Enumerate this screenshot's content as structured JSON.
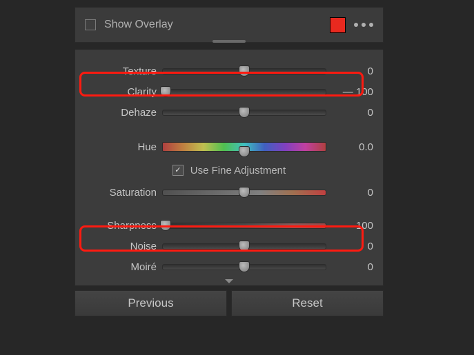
{
  "header": {
    "show_overlay_label": "Show Overlay",
    "swatch_color": "#e8291f"
  },
  "sliders": {
    "texture": {
      "label": "Texture",
      "value": "0",
      "pos": 50
    },
    "clarity": {
      "label": "Clarity",
      "value": "— 100",
      "pos": 0
    },
    "dehaze": {
      "label": "Dehaze",
      "value": "0",
      "pos": 50
    },
    "hue": {
      "label": "Hue",
      "value": "0.0",
      "pos": 50
    },
    "fine_adj": {
      "label": "Use Fine Adjustment"
    },
    "saturation": {
      "label": "Saturation",
      "value": "0",
      "pos": 50
    },
    "sharpness": {
      "label": "Sharpness",
      "value": "— 100",
      "pos": 0
    },
    "noise": {
      "label": "Noise",
      "value": "0",
      "pos": 50
    },
    "moire": {
      "label": "Moiré",
      "value": "0",
      "pos": 50
    }
  },
  "footer": {
    "previous": "Previous",
    "reset": "Reset"
  }
}
